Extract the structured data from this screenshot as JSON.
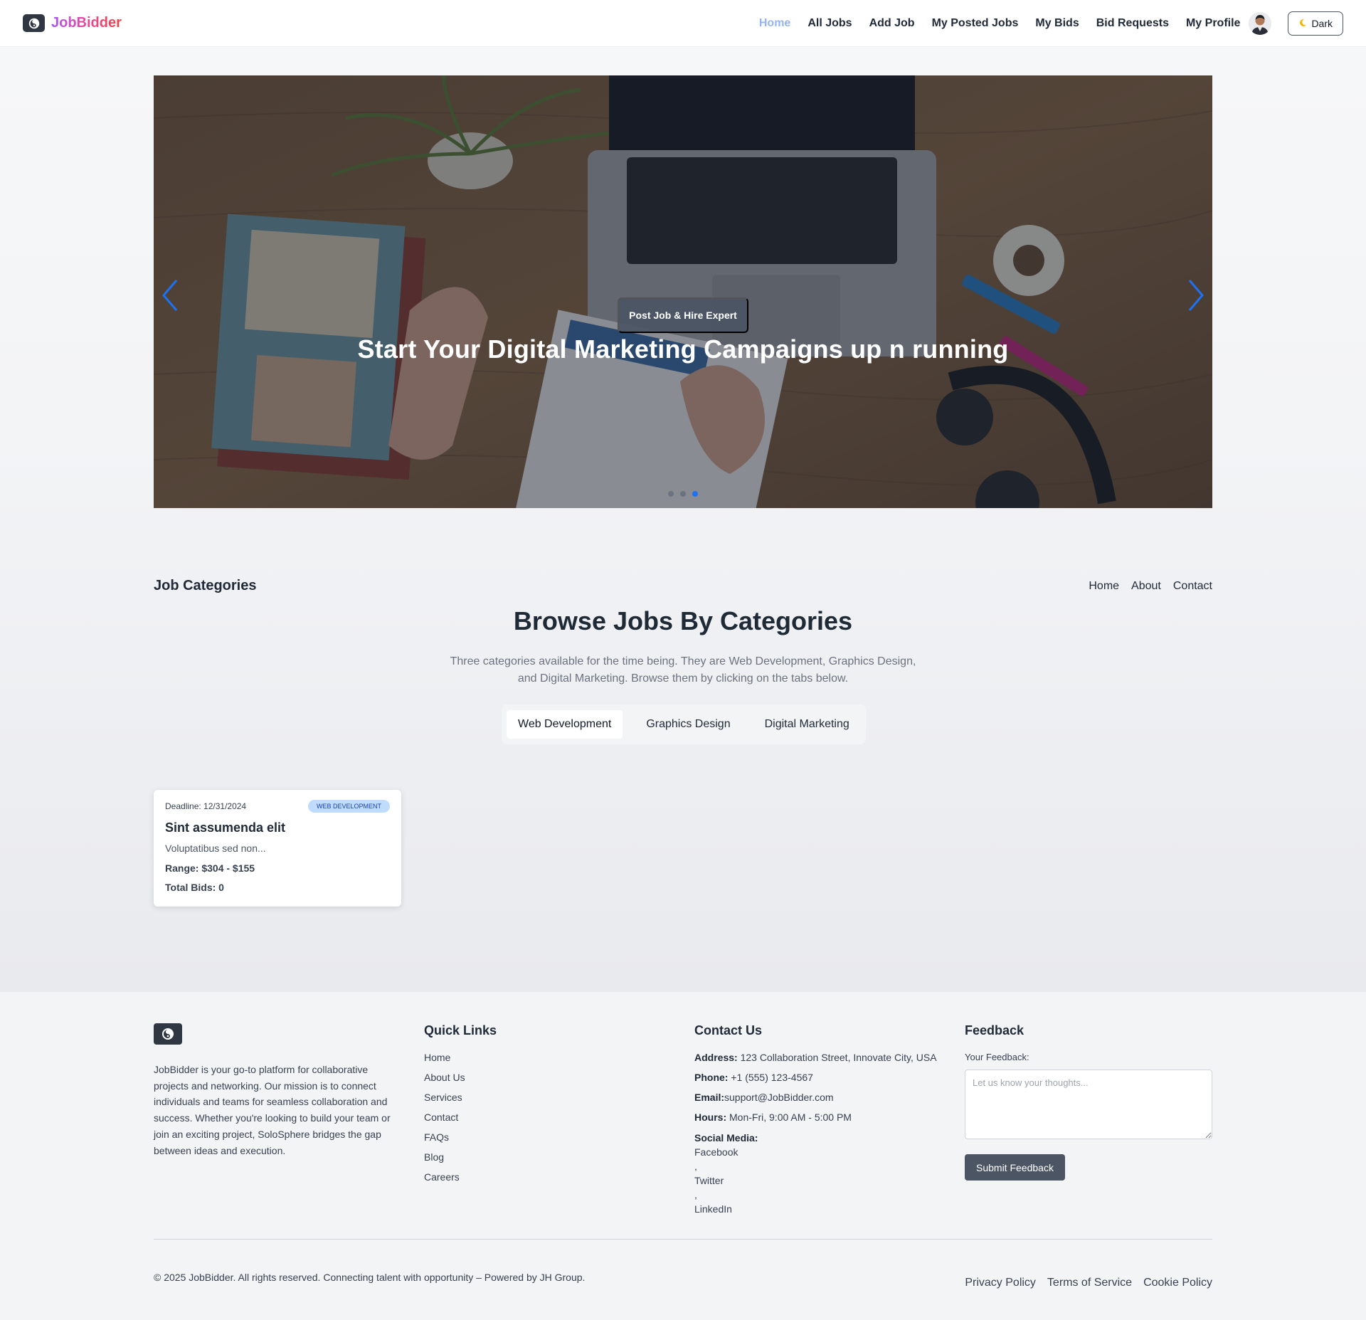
{
  "brand": {
    "name": "JobBidder",
    "logo_icon": "swirl-icon",
    "gradient": [
      "#a855f7",
      "#ec4899",
      "#ef4444"
    ]
  },
  "nav": {
    "links": [
      {
        "label": "Home",
        "active": true
      },
      {
        "label": "All Jobs"
      },
      {
        "label": "Add Job"
      },
      {
        "label": "My Posted Jobs"
      },
      {
        "label": "My Bids"
      },
      {
        "label": "Bid Requests"
      },
      {
        "label": "My Profile"
      }
    ],
    "theme_toggle": {
      "icon": "moon-icon",
      "label": "Dark"
    },
    "active_color": "#93b4f5"
  },
  "hero": {
    "title": "Start Your Digital Marketing Campaigns up n running",
    "cta": "Post Job & Hire Expert",
    "slides_count": 3,
    "active_slide": 3,
    "indicator_active_color": "#1d72f3"
  },
  "categories": {
    "header_title": "Job Categories",
    "header_links": [
      "Home",
      "About",
      "Contact"
    ],
    "title": "Browse Jobs By Categories",
    "description": "Three categories available for the time being. They are Web Development, Graphics Design, and Digital Marketing. Browse them by clicking on the tabs below.",
    "tabs": [
      "Web Development",
      "Graphics Design",
      "Digital Marketing"
    ],
    "active_tab": "Web Development"
  },
  "jobs": [
    {
      "deadline": "Deadline: 12/31/2024",
      "category": "WEB DEVELOPMENT",
      "title": "Sint assumenda elit",
      "description": "Voluptatibus sed non...",
      "range": "Range: $304 - $155",
      "bids": "Total Bids: 0"
    }
  ],
  "footer": {
    "about": "JobBidder is your go-to platform for collaborative projects and networking. Our mission is to connect individuals and teams for seamless collaboration and success. Whether you're looking to build your team or join an exciting project, SoloSphere bridges the gap between ideas and execution.",
    "quick_links": {
      "heading": "Quick Links",
      "items": [
        "Home",
        "About Us",
        "Services",
        "Contact",
        "FAQs",
        "Blog",
        "Careers"
      ]
    },
    "contact": {
      "heading": "Contact Us",
      "address_label": "Address:",
      "address": " 123 Collaboration Street, Innovate City, USA",
      "phone_label": "Phone:",
      "phone": " +1 (555) 123-4567",
      "email_label": "Email:",
      "email": "support@JobBidder.com",
      "hours_label": "Hours:",
      "hours": " Mon-Fri, 9:00 AM - 5:00 PM",
      "social_label": "Social Media:",
      "social": [
        "Facebook",
        "Twitter",
        "LinkedIn"
      ],
      "separator": ","
    },
    "feedback": {
      "heading": "Feedback",
      "label": "Your Feedback:",
      "placeholder": "Let us know your thoughts...",
      "submit": "Submit Feedback"
    },
    "copyright": "© 2025 JobBidder. All rights reserved. Connecting talent with opportunity – Powered by JH Group.",
    "legal": [
      "Privacy Policy",
      "Terms of Service",
      "Cookie Policy"
    ]
  }
}
